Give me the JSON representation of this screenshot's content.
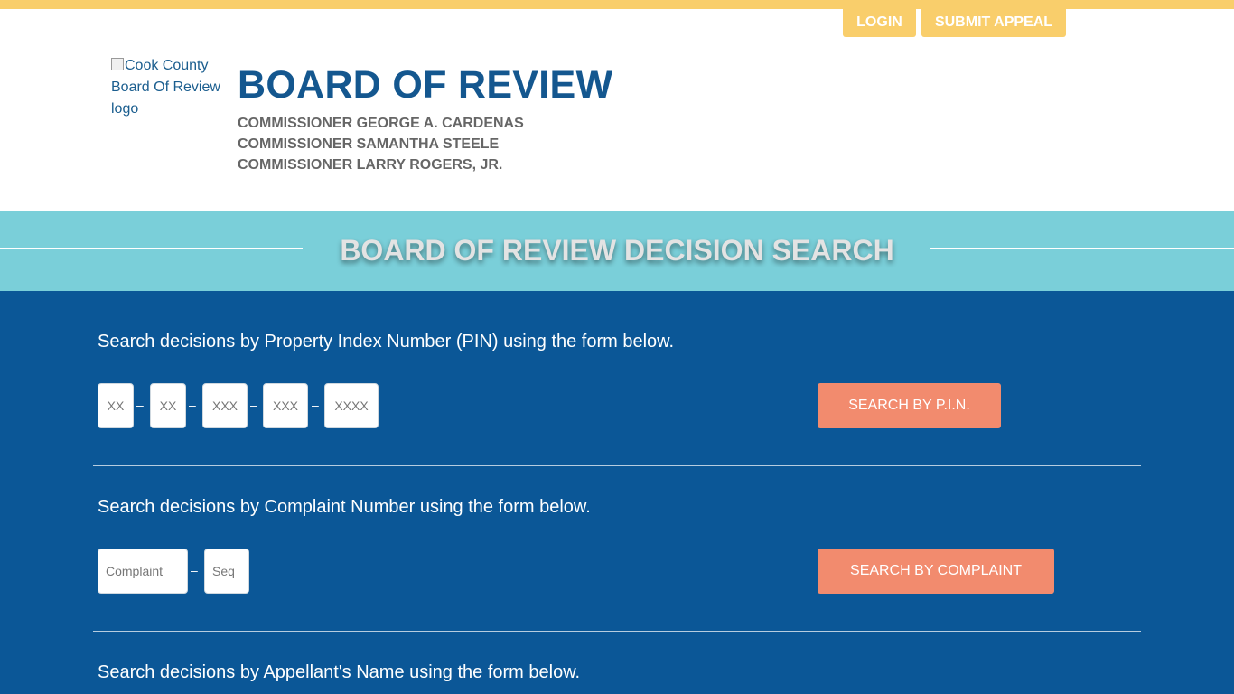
{
  "header": {
    "login_label": "LOGIN",
    "submit_appeal_label": "SUBMIT APPEAL",
    "logo_alt": "Cook County Board Of Review logo",
    "title": "BOARD OF REVIEW",
    "commissioners": [
      "COMMISSIONER GEORGE A. CARDENAS",
      "COMMISSIONER SAMANTHA STEELE",
      "COMMISSIONER LARRY ROGERS, JR."
    ]
  },
  "banner": {
    "title": "BOARD OF REVIEW DECISION SEARCH"
  },
  "pin_search": {
    "intro": "Search decisions by Property Index Number (PIN) using the form below.",
    "placeholders": [
      "XX",
      "XX",
      "XXX",
      "XXX",
      "XXXX"
    ],
    "separator": "–",
    "button_label": "SEARCH BY P.I.N."
  },
  "complaint_search": {
    "intro": "Search decisions by Complaint Number using the form below.",
    "complaint_placeholder": "Complaint",
    "seq_placeholder": "Seq",
    "separator": "–",
    "button_label": "SEARCH BY COMPLAINT"
  },
  "name_search": {
    "intro": "Search decisions by Appellant's Name using the form below."
  },
  "colors": {
    "accent_yellow": "#f9ce6b",
    "brand_blue": "#14578f",
    "main_blue": "#0b5797",
    "banner_teal": "#7acfd9",
    "button_salmon": "#f28b6e"
  }
}
